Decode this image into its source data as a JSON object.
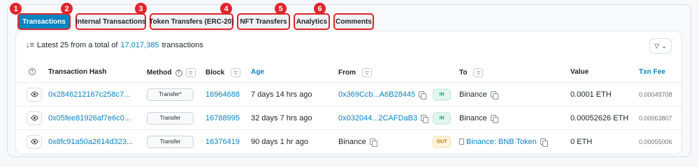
{
  "tabs": [
    {
      "badge": "1",
      "label": "Transactions"
    },
    {
      "badge": "2",
      "label": "Internal Transactions"
    },
    {
      "badge": "3",
      "label": "Token Transfers (ERC-20)"
    },
    {
      "badge": "4",
      "label": "NFT Transfers"
    },
    {
      "badge": "5",
      "label": "Analytics"
    },
    {
      "badge": "6",
      "label": "Comments"
    }
  ],
  "summary": {
    "prefix": "Latest 25 from a total of",
    "count": "17,017,385",
    "suffix": "transactions"
  },
  "table": {
    "headers": {
      "hash": "Transaction Hash",
      "method": "Method",
      "block": "Block",
      "age": "Age",
      "from": "From",
      "to": "To",
      "value": "Value",
      "fee": "Txn Fee"
    },
    "rows": [
      {
        "hash": "0x2846212167c258c7...",
        "method": "Transfer*",
        "block": "16964688",
        "age": "7 days 14 hrs ago",
        "from": "0x369Ccb...A6B28445",
        "direction": "IN",
        "to": "Binance",
        "value": "0.0001 ETH",
        "fee": "0.00049708"
      },
      {
        "hash": "0x05fee81926af7e6c0...",
        "method": "Transfer",
        "block": "16788995",
        "age": "32 days 7 hrs ago",
        "from": "0x032044...2CAFDaB3",
        "direction": "IN",
        "to": "Binance",
        "value": "0.00052626 ETH",
        "fee": "0.00063807"
      },
      {
        "hash": "0x8fc91a50a2614d323...",
        "method": "Transfer",
        "block": "16376419",
        "age": "90 days 1 hr ago",
        "from": "Binance",
        "direction": "OUT",
        "to": "Binance: BNB Token",
        "value": "0 ETH",
        "fee": "0.00055006"
      }
    ]
  },
  "colors": {
    "accent": "#0784c3",
    "highlight": "#e0252b",
    "in_badge": "#00a186",
    "out_badge": "#b47d00"
  }
}
